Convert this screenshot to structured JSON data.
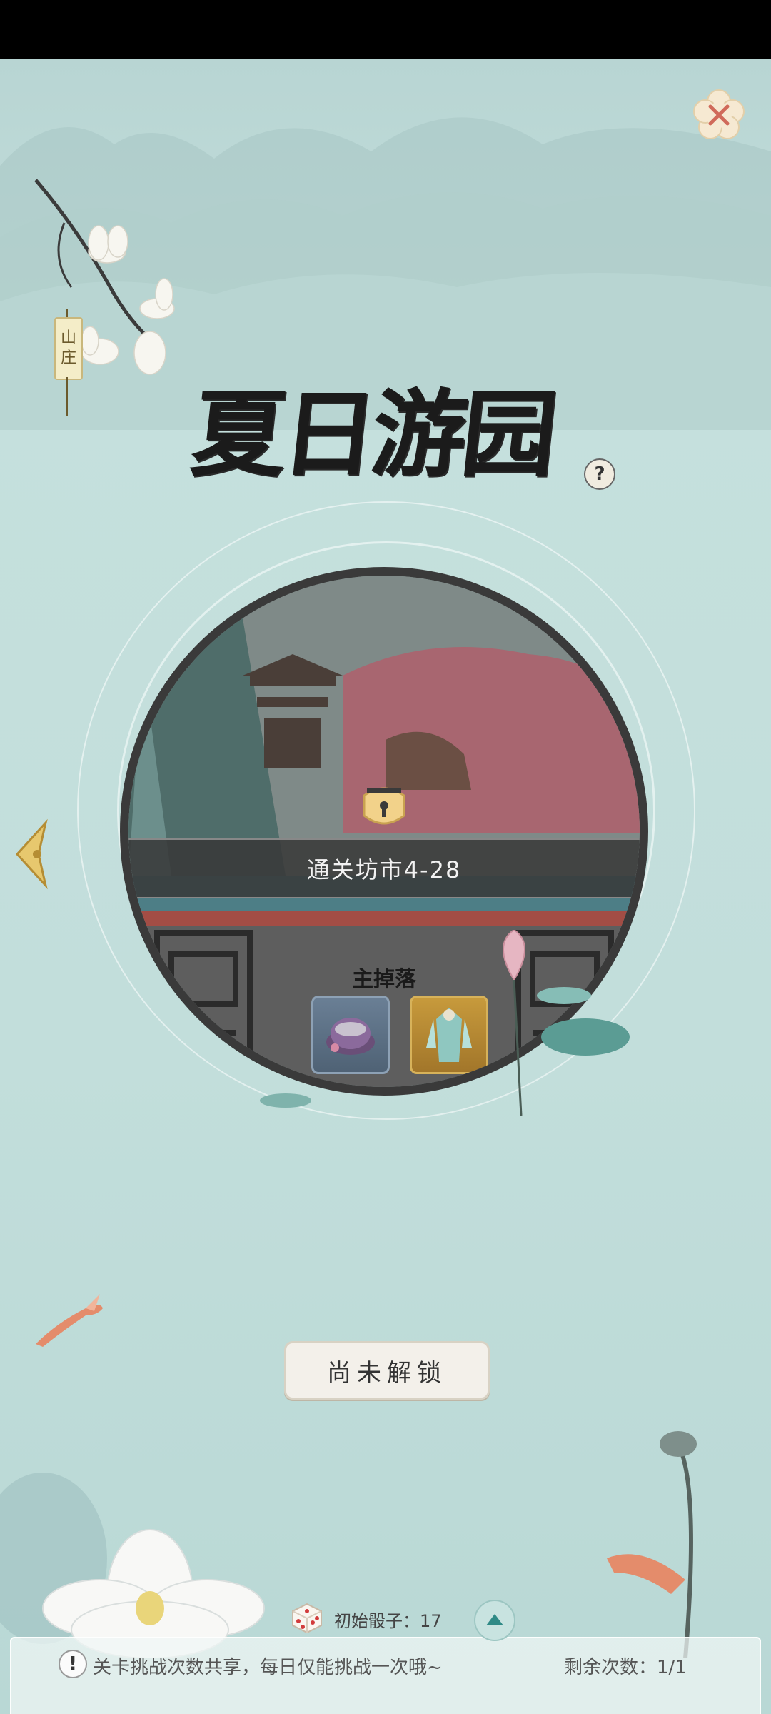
{
  "header": {
    "scroll_tag_line1": "山",
    "scroll_tag_line2": "庄",
    "title": "夏日游园",
    "help_symbol": "?"
  },
  "stage": {
    "banner_text": "通关坊市4-28",
    "drops_label": "主掉落",
    "drops": [
      {
        "name": "purple-hat-item",
        "icon": "hat-icon"
      },
      {
        "name": "costume-item",
        "icon": "costume-icon"
      }
    ]
  },
  "actions": {
    "unlock_label": "尚未解锁"
  },
  "footer": {
    "dice_label": "初始骰子：17",
    "notice": "关卡挑战次数共享，每日仅能挑战一次哦~",
    "remaining": "剩余次数：1/1"
  },
  "colors": {
    "background": "#c2dedb",
    "banner": "#373737",
    "title": "#1b1b1b",
    "close_accent": "#d06a5a"
  }
}
